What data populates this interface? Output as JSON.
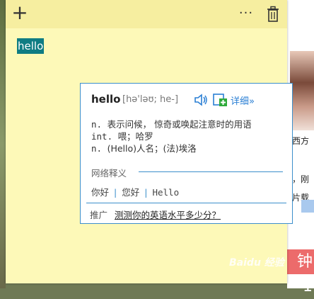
{
  "note": {
    "selected_text": "hello",
    "icons": {
      "add": "plus-icon",
      "more": "ellipsis-icon",
      "delete": "trash-icon"
    },
    "more_glyph": "···"
  },
  "dictionary": {
    "word": "hello",
    "phonetic": "[hə'ləʊ; he-]",
    "more_details": "详细»",
    "definitions": [
      {
        "pos": "n.",
        "text": "表示问候， 惊奇或唤起注意时的用语"
      },
      {
        "pos": "int.",
        "text": "喂；哈罗"
      },
      {
        "pos": "n.",
        "text": "(Hello)人名；(法)埃洛"
      }
    ],
    "web_section_label": "网络释义",
    "web_translations": [
      "你好",
      "您好",
      "Hello"
    ],
    "promo_label": "推广",
    "promo_link": "测测你的英语水平多少分？",
    "accent_color": "#3c8fcb"
  },
  "background": {
    "text_lines": [
      "西方",
      "，刚",
      "片载"
    ],
    "red_button_text": "钟 1",
    "watermark": "Baidu 经验"
  }
}
